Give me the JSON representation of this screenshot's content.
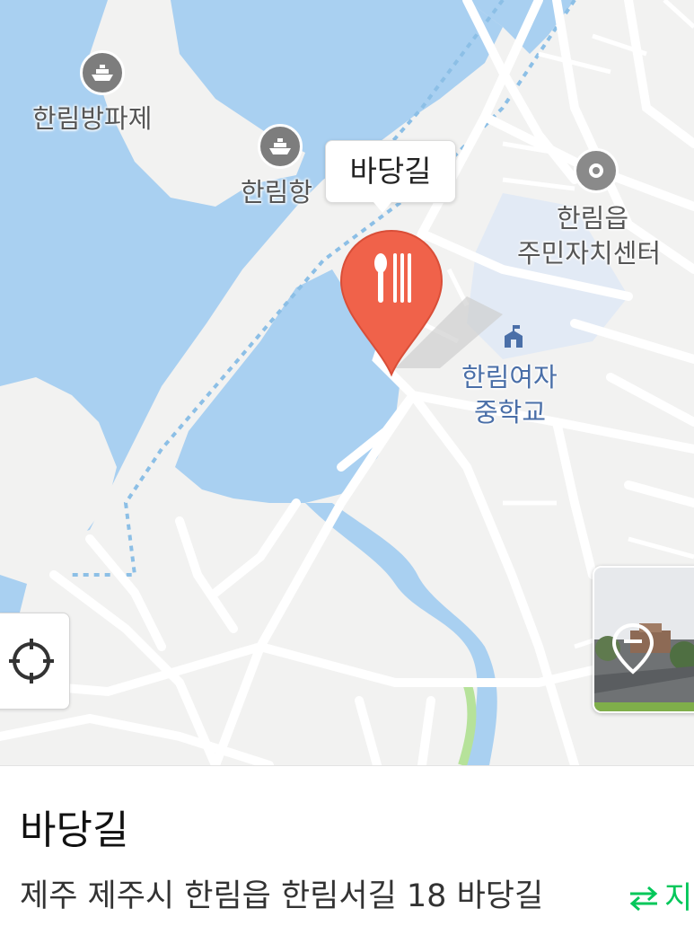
{
  "map": {
    "poi_labels": {
      "breakwater": "한림방파제",
      "port": "한림항",
      "community_center_line1": "한림읍",
      "community_center_line2": "주민자치센터",
      "school_line1": "한림여자",
      "school_line2": "중학교"
    },
    "callout_label": "바당길",
    "pin_category_icon": "restaurant-fork-knife-icon",
    "colors": {
      "water": "#a9d0f1",
      "land": "#f2f2f1",
      "road": "#ffffff",
      "school_area": "#e2eaf5",
      "pin": "#f0624a",
      "green_stream": "#b6e29a"
    }
  },
  "place": {
    "title": "바당길",
    "address": "제주 제주시 한림읍 한림서길 18 바당길",
    "direction_label": "지"
  }
}
